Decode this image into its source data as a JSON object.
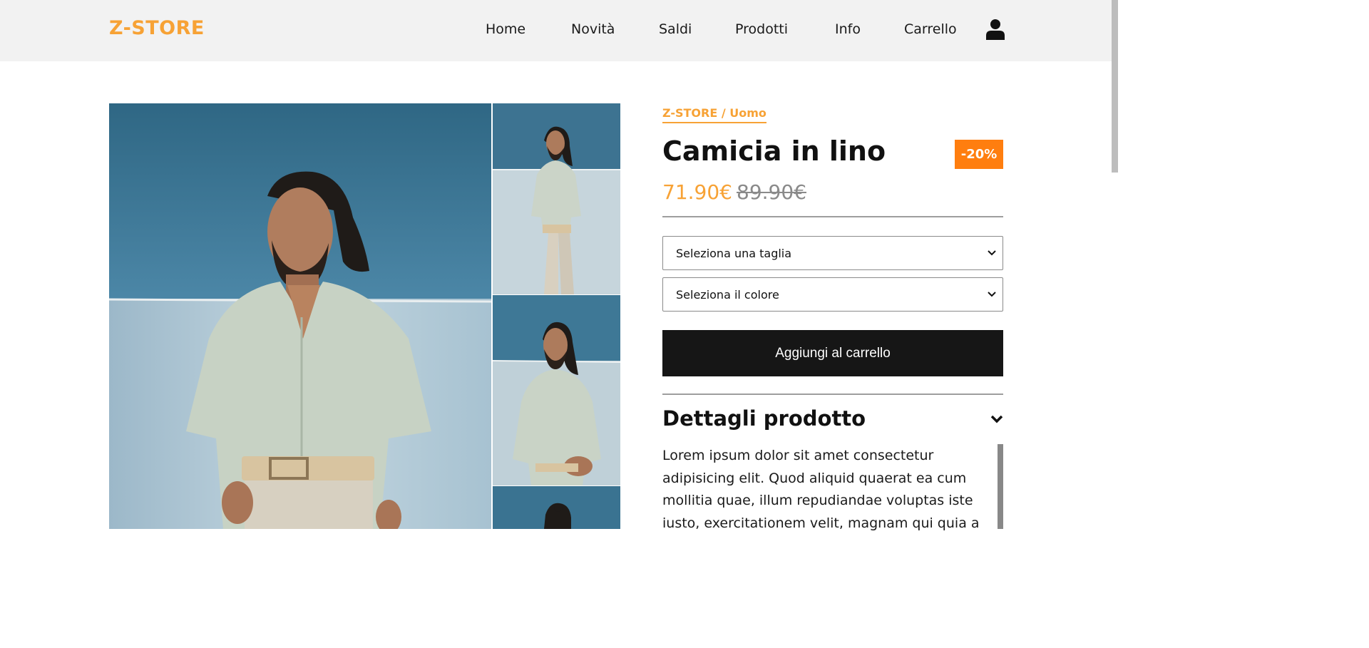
{
  "header": {
    "logo": "Z-STORE",
    "nav": [
      "Home",
      "Novità",
      "Saldi",
      "Prodotti",
      "Info",
      "Carrello"
    ],
    "user_icon": "user-icon"
  },
  "product": {
    "breadcrumb": "Z-STORE / Uomo",
    "title": "Camicia in lino",
    "discount": "-20%",
    "price": "71.90€",
    "old_price": "89.90€",
    "size_select": "Seleziona una taglia",
    "color_select": "Seleziona il colore",
    "add_to_cart": "Aggiungi al carrello",
    "details_title": "Dettagli prodotto",
    "details_text": "Lorem ipsum dolor sit amet consectetur adipisicing elit. Quod aliquid quaerat ea cum mollitia quae, illum repudiandae voluptas iste iusto, exercitationem velit, magnam qui quia a"
  },
  "colors": {
    "accent": "#f7a235",
    "badge": "#ff7e0f",
    "button": "#161616",
    "header_bg": "#f2f2f2"
  }
}
